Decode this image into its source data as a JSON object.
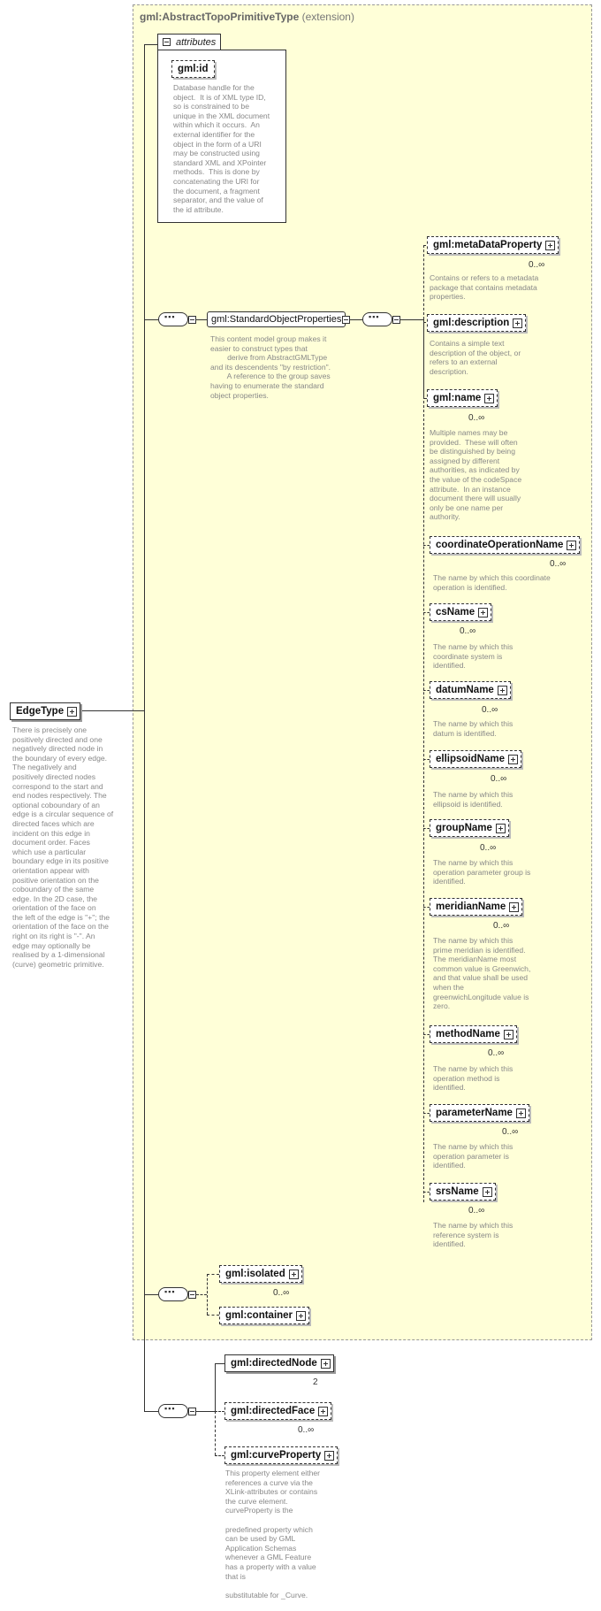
{
  "extension": {
    "type_name": "gml:AbstractTopoPrimitiveType",
    "suffix": "(extension)"
  },
  "attributes": {
    "tab_label": "attributes",
    "id": {
      "name": "gml:id",
      "description": "Database handle for the\nobject.  It is of XML type ID,\nso is constrained to be\nunique in the XML document\nwithin which it occurs.  An\nexternal identifier for the\nobject in the form of a URI\nmay be constructed using\nstandard XML and XPointer\nmethods.  This is done by\nconcatenating the URI for\nthe document, a fragment\nseparator, and the value of\nthe id attribute."
    }
  },
  "standard_group": {
    "name": "gml:StandardObjectProperties",
    "description": "This content model group makes it\neasier to construct types that\n        derive from AbstractGMLType\nand its descendents \"by restriction\".\n        A reference to the group saves\nhaving to enumerate the standard\nobject properties."
  },
  "meta": {
    "name": "gml:metaDataProperty",
    "card": "0..∞",
    "description": "Contains or refers to a metadata\npackage that contains metadata\nproperties."
  },
  "gml_description": {
    "name": "gml:description",
    "description": "Contains a simple text\ndescription of the object, or\nrefers to an external\ndescription."
  },
  "gml_name": {
    "name": "gml:name",
    "card": "0..∞",
    "description": "Multiple names may be\nprovided.  These will often\nbe distinguished by being\nassigned by different\nauthorities, as indicated by\nthe value of the codeSpace\nattribute.  In an instance\ndocument there will usually\nonly be one name per\nauthority."
  },
  "subs": [
    {
      "name": "coordinateOperationName",
      "card": "0..∞",
      "description": "The name by which this coordinate\noperation is identified."
    },
    {
      "name": "csName",
      "card": "0..∞",
      "description": "The name by which this\ncoordinate system is\nidentified."
    },
    {
      "name": "datumName",
      "card": "0..∞",
      "description": "The name by which this\ndatum is identified."
    },
    {
      "name": "ellipsoidName",
      "card": "0..∞",
      "description": "The name by which this\nellipsoid is identified."
    },
    {
      "name": "groupName",
      "card": "0..∞",
      "description": "The name by which this\noperation parameter group is\nidentified."
    },
    {
      "name": "meridianName",
      "card": "0..∞",
      "description": "The name by which this\nprime meridian is identified.\nThe meridianName most\ncommon value is Greenwich,\nand that value shall be used\nwhen the\ngreenwichLongitude value is\nzero."
    },
    {
      "name": "methodName",
      "card": "0..∞",
      "description": "The name by which this\noperation method is\nidentified."
    },
    {
      "name": "parameterName",
      "card": "0..∞",
      "description": "The name by which this\noperation parameter is\nidentified."
    },
    {
      "name": "srsName",
      "card": "0..∞",
      "description": "The name by which this\nreference system is\nidentified."
    }
  ],
  "isolated": {
    "name": "gml:isolated",
    "card": "0..∞"
  },
  "container": {
    "name": "gml:container"
  },
  "directedNode": {
    "name": "gml:directedNode",
    "card": "2"
  },
  "directedFace": {
    "name": "gml:directedFace",
    "card": "0..∞"
  },
  "curveProperty": {
    "name": "gml:curveProperty",
    "description": "This property element either\nreferences a curve via the\nXLink-attributes or contains\nthe curve element.\ncurveProperty is the\n\npredefined property which\ncan be used by GML\nApplication Schemas\nwhenever a GML Feature\nhas a property with a value\nthat is\n\nsubstitutable for _Curve."
  },
  "edge": {
    "name": "EdgeType",
    "description": "There is precisely one\npositively directed and one\nnegatively directed node in\nthe boundary of every edge.\nThe negatively and\npositively directed nodes\ncorrespond to the start and\nend nodes respectively. The\noptional coboundary of an\nedge is a circular sequence of\ndirected faces which are\nincident on this edge in\ndocument order. Faces\nwhich use a particular\nboundary edge in its positive\norientation appear with\npositive orientation on the\ncoboundary of the same\nedge. In the 2D case, the\norientation of the face on\nthe left of the edge is \"+\"; the\norientation of the face on the\nright on its right is \"-\". An\nedge may optionally be\nrealised by a 1-dimensional\n(curve) geometric primitive."
  }
}
